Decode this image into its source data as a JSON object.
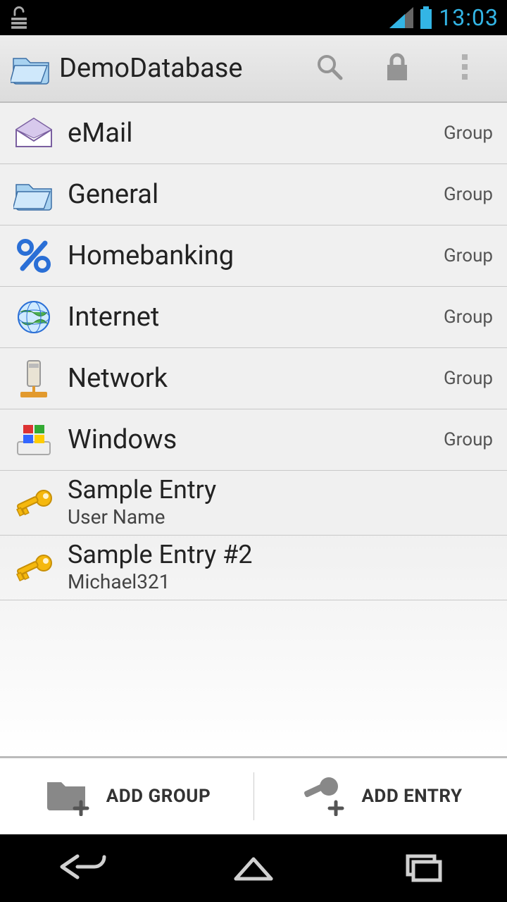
{
  "status": {
    "time": "13:03"
  },
  "header": {
    "title": "DemoDatabase"
  },
  "groups": [
    {
      "name": "eMail",
      "tag": "Group",
      "icon": "mail"
    },
    {
      "name": "General",
      "tag": "Group",
      "icon": "folder"
    },
    {
      "name": "Homebanking",
      "tag": "Group",
      "icon": "percent"
    },
    {
      "name": "Internet",
      "tag": "Group",
      "icon": "globe"
    },
    {
      "name": "Network",
      "tag": "Group",
      "icon": "server"
    },
    {
      "name": "Windows",
      "tag": "Group",
      "icon": "windows"
    }
  ],
  "entries": [
    {
      "title": "Sample Entry",
      "subtitle": "User Name"
    },
    {
      "title": "Sample Entry #2",
      "subtitle": "Michael321"
    }
  ],
  "bottom": {
    "add_group": "ADD GROUP",
    "add_entry": "ADD ENTRY"
  }
}
